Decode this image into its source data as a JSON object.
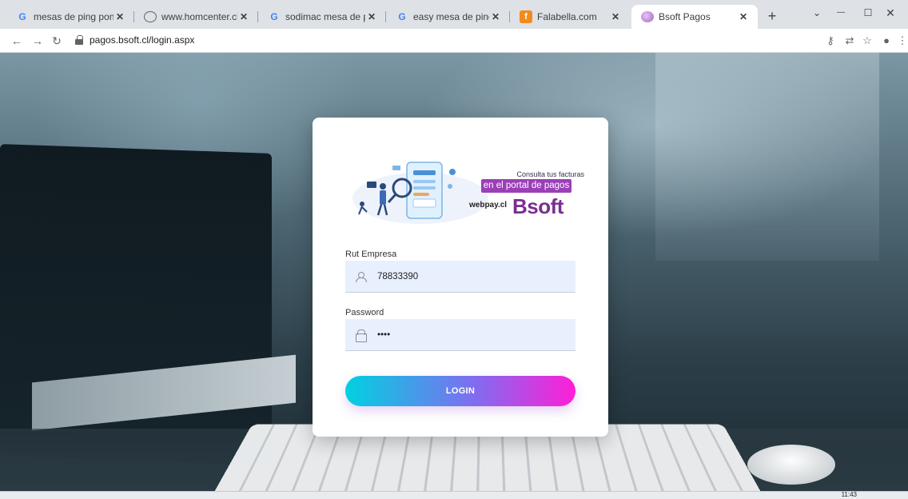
{
  "browser": {
    "tabs": [
      {
        "title": "mesas de ping pong barata",
        "favicon": "google-icon",
        "active": false
      },
      {
        "title": "www.homcenter.cl",
        "favicon": "globe-icon",
        "active": false
      },
      {
        "title": "sodimac mesa de ping pong",
        "favicon": "google-icon",
        "active": false
      },
      {
        "title": "easy mesa de ping - Buscar",
        "favicon": "google-icon",
        "active": false
      },
      {
        "title": "Falabella.com",
        "favicon": "falabella-icon",
        "active": false
      },
      {
        "title": "Bsoft Pagos",
        "favicon": "bsoft-icon",
        "active": true
      }
    ],
    "glyphs": {
      "google": "G",
      "falabella": "f",
      "close": "✕",
      "newtab": "+",
      "minimize": "—",
      "maximize": "☐",
      "winclose": "✕",
      "dropdown": "⌄",
      "back": "←",
      "forward": "→",
      "reload": "↻",
      "key": "⚷",
      "translate": "⇄",
      "star": "☆",
      "profile": "●",
      "menu": "⋮"
    },
    "address": "pagos.bsoft.cl/login.aspx"
  },
  "banner": {
    "tagline_small": "Consulta tus facturas",
    "tagline_highlight": "en el portal de pagos",
    "webpay_logo": "webpay.cl",
    "brand": "Bsoft"
  },
  "login": {
    "rut_label": "Rut Empresa",
    "rut_value": "78833390",
    "password_label": "Password",
    "password_value": "••••",
    "button_label": "LOGIN"
  },
  "taskbar": {
    "clock": "11:43"
  },
  "colors": {
    "accent_start": "#00d1e0",
    "accent_end": "#ff1ed7",
    "brand_purple": "#9b3fb7",
    "field_bg": "#e8f0fe"
  }
}
